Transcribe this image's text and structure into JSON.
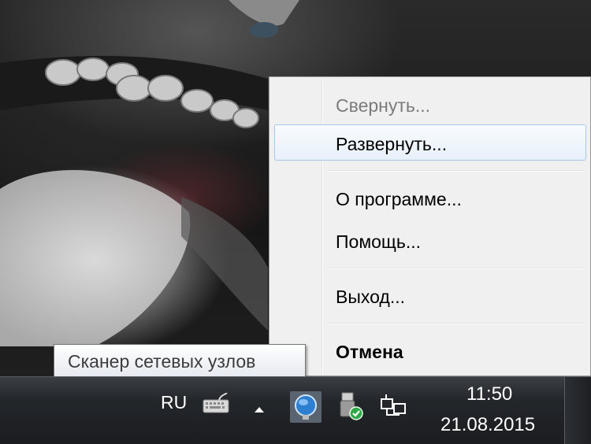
{
  "tooltip": {
    "text": "Сканер сетевых узлов"
  },
  "context_menu": {
    "items": [
      {
        "label": "Свернуть...",
        "state": "disabled"
      },
      {
        "label": "Развернуть...",
        "state": "hover"
      },
      {
        "label": "О программе...",
        "state": "normal"
      },
      {
        "label": "Помощь...",
        "state": "normal"
      },
      {
        "label": "Выход...",
        "state": "normal"
      },
      {
        "label": "Отмена",
        "state": "default"
      }
    ]
  },
  "taskbar": {
    "language": "RU",
    "time": "11:50",
    "date": "21.08.2015",
    "tray_icons": [
      "keyboard-icon",
      "show-hidden-icons-icon",
      "network-scanner-icon",
      "usb-safely-remove-icon",
      "network-icon"
    ]
  },
  "colors": {
    "menu_bg": "#f0f0f0",
    "hover_border": "#a8c7ea",
    "taskbar": "#1b1d20"
  }
}
